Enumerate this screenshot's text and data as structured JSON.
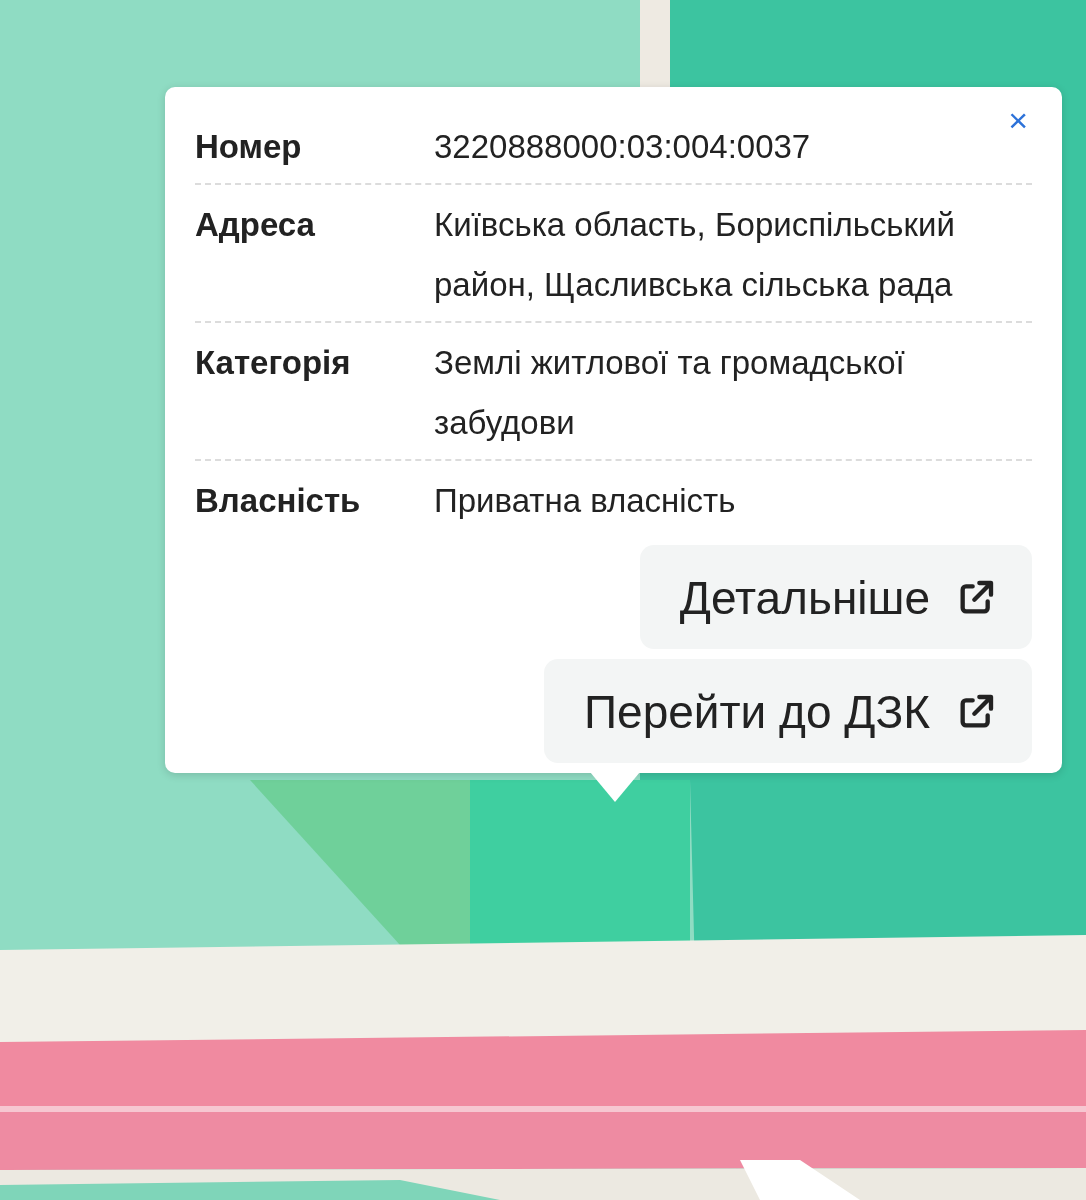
{
  "popup": {
    "close_label": "×",
    "rows": [
      {
        "label": "Номер",
        "value": "3220888000:03:004:0037"
      },
      {
        "label": "Адреса",
        "value": "Київська область, Бориспільський район, Щасливська сільська рада"
      },
      {
        "label": "Категорія",
        "value": "Землі житлової та громадської забудови"
      },
      {
        "label": "Власність",
        "value": "Приватна власність"
      }
    ],
    "links": [
      {
        "label": "Детальніше"
      },
      {
        "label": "Перейти до ДЗК"
      }
    ]
  }
}
